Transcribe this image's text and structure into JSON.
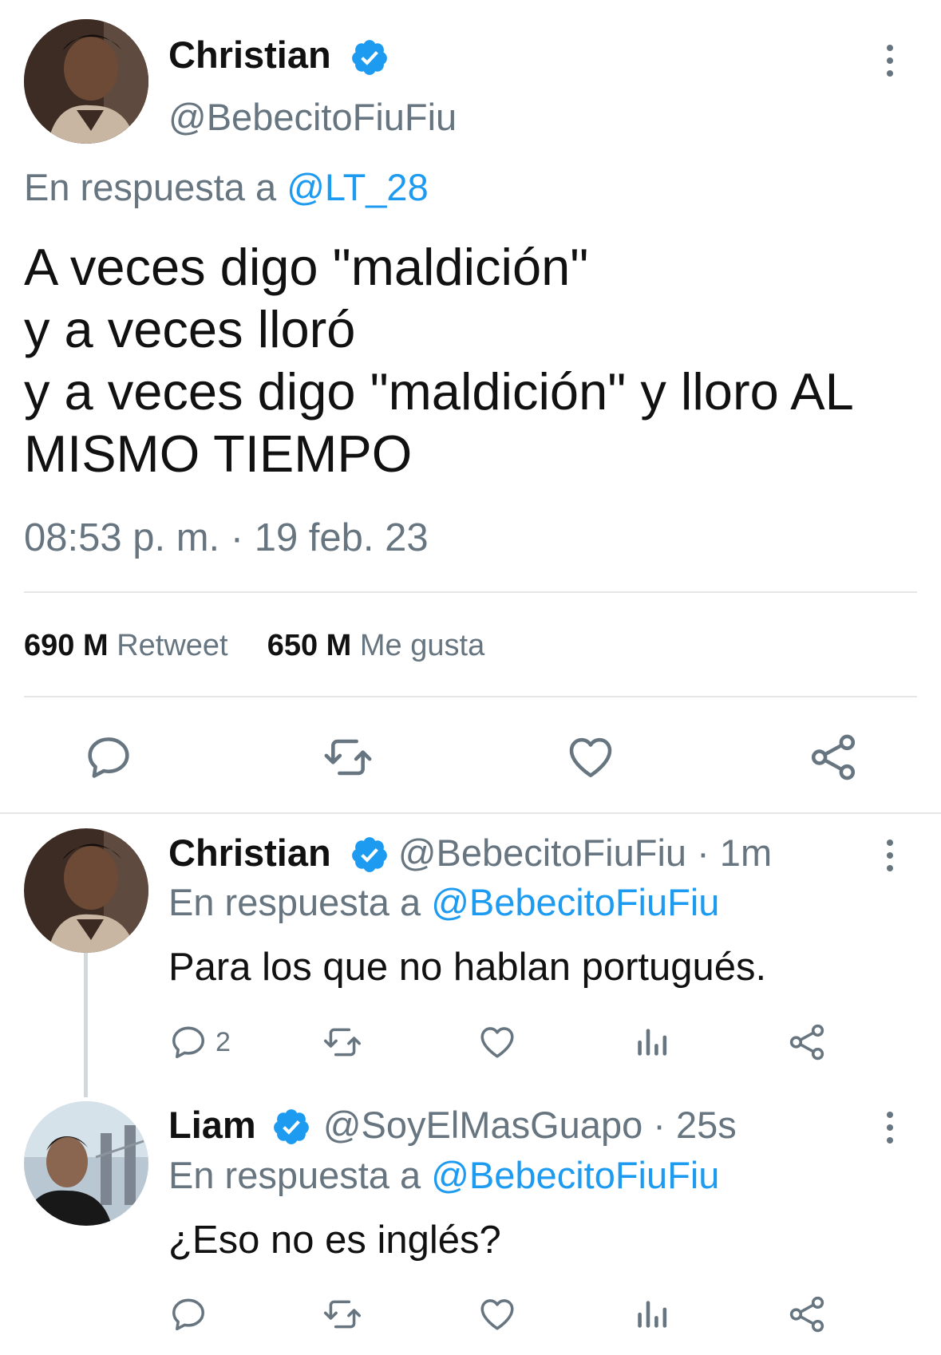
{
  "main_tweet": {
    "author_name": "Christian",
    "handle": "@BebecitoFiuFiu",
    "reply_prefix": "En respuesta a",
    "reply_to": "@LT_28",
    "text_lines": [
      "A veces digo \"maldición\"",
      "y a veces lloró",
      "y a veces digo \"maldición\" y lloro AL",
      "MISMO TIEMPO"
    ],
    "timestamp": "08:53 p. m. · 19 feb. 23",
    "retweet_count": "690 M",
    "retweet_label": "Retweet",
    "like_count": "650 M",
    "like_label": "Me gusta"
  },
  "replies": [
    {
      "author_name": "Christian",
      "handle": "@BebecitoFiuFiu",
      "time": "· 1m",
      "reply_prefix": "En respuesta a",
      "reply_to": "@BebecitoFiuFiu",
      "text": "Para los que no hablan portugués.",
      "reply_count": "2"
    },
    {
      "author_name": "Liam",
      "handle": "@SoyElMasGuapo",
      "time": "· 25s",
      "reply_prefix": "En respuesta a",
      "reply_to": "@BebecitoFiuFiu",
      "text": "¿Eso no es inglés?",
      "reply_count": ""
    }
  ],
  "icons": {
    "verified": "verified-badge-icon",
    "more": "more-vertical-icon",
    "reply": "reply-icon",
    "retweet": "retweet-icon",
    "like": "heart-icon",
    "stats": "stats-icon",
    "share": "share-icon"
  },
  "colors": {
    "accent": "#1d9bf0",
    "muted": "#66757f",
    "text": "#111111",
    "divider": "#e6e6e6"
  }
}
